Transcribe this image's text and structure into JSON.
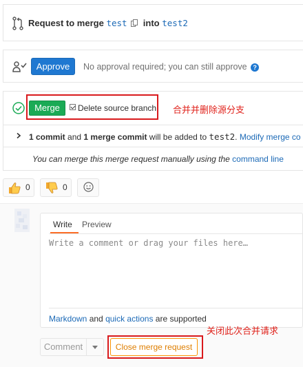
{
  "header": {
    "prefix": "Request to merge",
    "source_branch": "test",
    "into": "into",
    "target_branch": "test2"
  },
  "approval": {
    "button_label": "Approve",
    "note": "No approval required; you can still approve"
  },
  "merge": {
    "button_label": "Merge",
    "delete_source_label": "Delete source branch",
    "delete_source_checked": true,
    "annotation_merge_delete": "合并并删除源分支",
    "commits_count": "1 commit",
    "commits_and": "and",
    "merge_commits_count": "1 merge commit",
    "commits_suffix": "will be added to",
    "commits_target": "test2",
    "commits_dot": ".",
    "modify_link": "Modify merge co",
    "manual_text": "You can merge this merge request manually using the",
    "manual_link": "command line"
  },
  "awards": {
    "thumbs_up_count": "0",
    "thumbs_down_count": "0"
  },
  "comment": {
    "tab_write": "Write",
    "tab_preview": "Preview",
    "placeholder": "Write a comment or drag your files here…",
    "markdown_link": "Markdown",
    "and": "and",
    "quick_actions_link": "quick actions",
    "supported": "are supported",
    "comment_button": "Comment",
    "close_button": "Close merge request",
    "annotation_close": "关闭此次合并请求"
  },
  "colors": {
    "merge_green": "#1aaa55",
    "approve_blue": "#1f78d1",
    "link_blue": "#1b69b6",
    "annotation_red": "#e0221b",
    "close_orange": "#fc9403"
  }
}
